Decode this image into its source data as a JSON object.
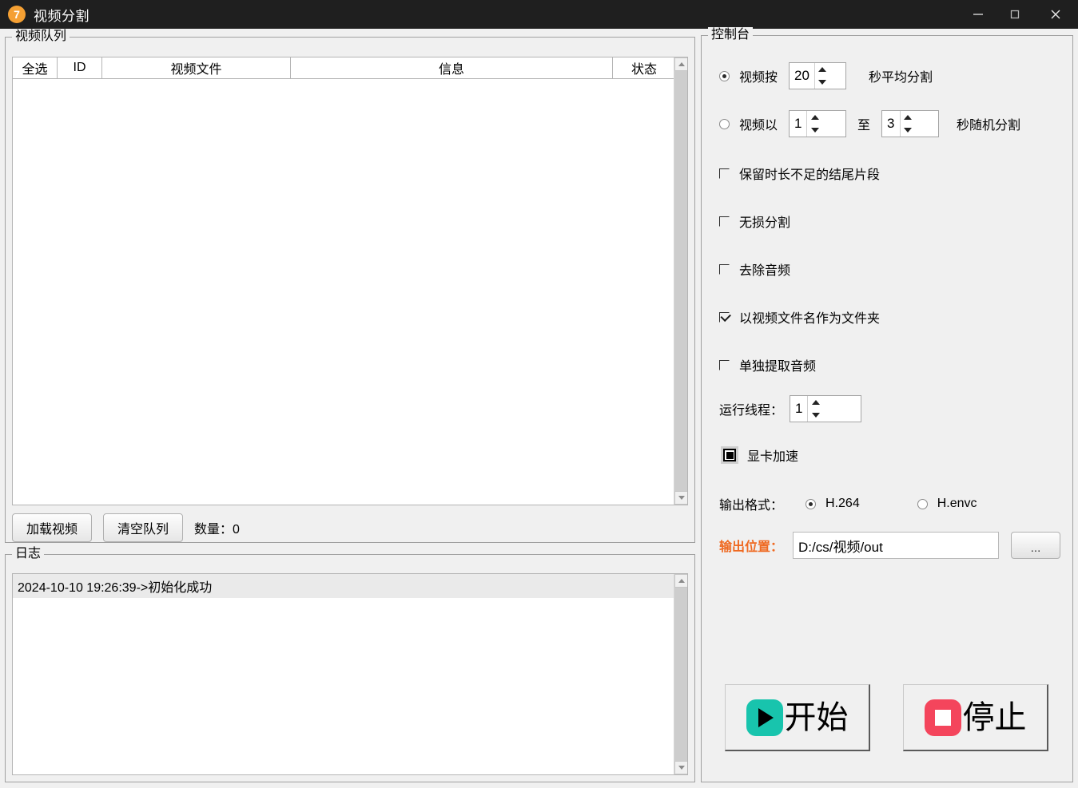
{
  "window": {
    "title": "视频分割",
    "icon_badge": "7",
    "icon_name": "app-badge-7",
    "controls": {
      "minimize": "minimize-icon",
      "maximize": "maximize-icon",
      "close": "close-icon"
    },
    "accent_orange": "#f5a033",
    "label_orange": "#ef6a22"
  },
  "queue": {
    "legend": "视频队列",
    "columns": [
      "全选",
      "ID",
      "视频文件",
      "信息",
      "状态"
    ],
    "rows": [],
    "load_button": "加载视频",
    "clear_button": "清空队列",
    "count_label": "数量：0"
  },
  "log": {
    "legend": "日志",
    "lines": [
      "2024-10-10 19:26:39->初始化成功"
    ]
  },
  "console": {
    "legend": "控制台",
    "mode_average": {
      "label": "视频按",
      "selected": true,
      "value": "20",
      "suffix": "秒平均分割"
    },
    "mode_random": {
      "label": "视频以",
      "selected": false,
      "min_value": "1",
      "between": "至",
      "max_value": "3",
      "suffix": "秒随机分割"
    },
    "checkboxes": [
      {
        "label": "保留时长不足的结尾片段",
        "checked": false
      },
      {
        "label": "无损分割",
        "checked": false
      },
      {
        "label": "去除音频",
        "checked": false
      },
      {
        "label": "以视频文件名作为文件夹",
        "checked": true
      },
      {
        "label": "单独提取音频",
        "checked": false
      }
    ],
    "threads": {
      "label": "运行线程：",
      "value": "1"
    },
    "gpu": {
      "label": "显卡加速",
      "state": "filled"
    },
    "output_format": {
      "label": "输出格式：",
      "options": [
        {
          "label": "H.264",
          "selected": true
        },
        {
          "label": "H.envc",
          "selected": false
        }
      ]
    },
    "output_path": {
      "label": "输出位置：",
      "value": "D:/cs/视频/out",
      "browse_button": "..."
    },
    "actions": {
      "start": {
        "label": "开始",
        "icon": "play-icon",
        "color": "#18c4ad"
      },
      "stop": {
        "label": "停止",
        "icon": "stop-icon",
        "color": "#f4455c"
      }
    }
  }
}
